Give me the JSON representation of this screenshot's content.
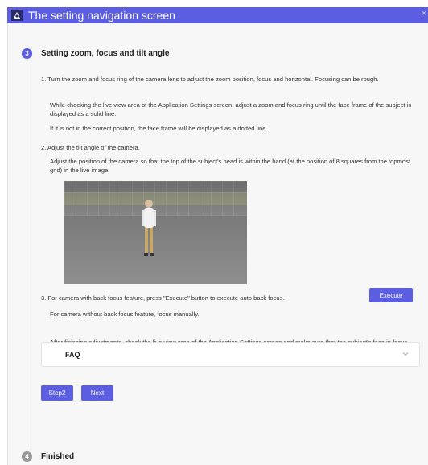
{
  "window": {
    "title": "The setting navigation screen",
    "close_label": "×"
  },
  "step3": {
    "number": "3",
    "title": "Setting zoom, focus and tilt angle",
    "item1_text": "1. Turn the zoom and focus ring of the camera lens to adjust the zoom position, focus and horizontal. Focusing can be rough.",
    "item1_detail1": "While checking the live view area of the Application Settings screen, adjust a zoom and focus ring until the face frame of the subject is displayed as a solid line.",
    "item1_detail2": "If it is not in the correct position, the face frame will be displayed as a dotted line.",
    "item2_text": "2. Adjust the tilt angle of the camera.",
    "item2_detail": "Adjust the position of the camera so that the top of the subject's head is within the band (at the position of 8 squares from the topmost grid) in the live image.",
    "item3_text": "3. For camera with back focus feature, press \"Execute\" button to execute auto back focus.",
    "execute_label": "Execute",
    "item3_detail": "For camera without back focus feature, focus manually.",
    "after_text": "After finishing adjustments, check the live view area of the Application Settings screen and make sure that the subject's face in focus."
  },
  "faq": {
    "label": "FAQ"
  },
  "nav": {
    "back_label": "Step2",
    "next_label": "Next"
  },
  "step4": {
    "number": "4",
    "title": "Finished"
  },
  "icons": {
    "app": "settings-app-icon",
    "faq_chevron": "chevron-down-icon"
  },
  "colors": {
    "accent": "#5b5ee0",
    "inactive_step": "#9a9a9a"
  }
}
